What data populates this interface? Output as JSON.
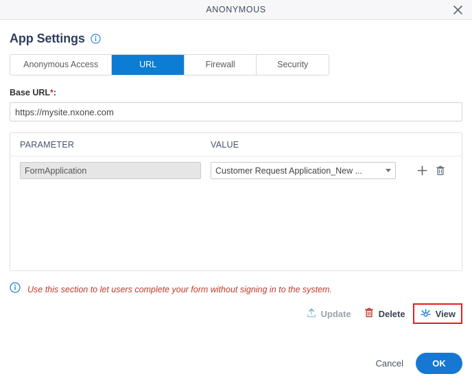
{
  "window": {
    "title": "ANONYMOUS",
    "close_icon": "close-icon"
  },
  "section": {
    "title": "App Settings",
    "info_icon": "info-icon"
  },
  "tabs": [
    {
      "label": "Anonymous Access",
      "active": false
    },
    {
      "label": "URL",
      "active": true
    },
    {
      "label": "Firewall",
      "active": false
    },
    {
      "label": "Security",
      "active": false
    }
  ],
  "base_url": {
    "label": "Base URL",
    "required_marker": "*",
    "colon": ":",
    "value": "https://mysite.nxone.com",
    "placeholder": "https://mysite.nxone.com"
  },
  "parameter_table": {
    "columns": [
      "PARAMETER",
      "VALUE"
    ],
    "rows": [
      {
        "parameter": "FormApplication",
        "value": "Customer Request Application_New ...",
        "add_icon": "plus-icon",
        "delete_icon": "trash-icon"
      }
    ]
  },
  "note": {
    "icon": "info-icon",
    "text": "Use this section to let users complete your form without signing in to the system."
  },
  "actions": [
    {
      "label": "Update",
      "icon": "upload-icon",
      "state": "disabled"
    },
    {
      "label": "Delete",
      "icon": "trash-icon",
      "state": "enabled"
    },
    {
      "label": "View",
      "icon": "preview-icon",
      "state": "highlighted"
    }
  ],
  "footer": {
    "cancel_label": "Cancel",
    "ok_label": "OK"
  },
  "colors": {
    "accent_blue": "#0c7cd5",
    "ok_blue": "#1578d3",
    "title_navy": "#3e4b63",
    "note_red": "#c0392b",
    "highlight_red": "#e81c1c",
    "delete_red": "#c0392b",
    "disabled_grey": "#9aa3ad"
  }
}
